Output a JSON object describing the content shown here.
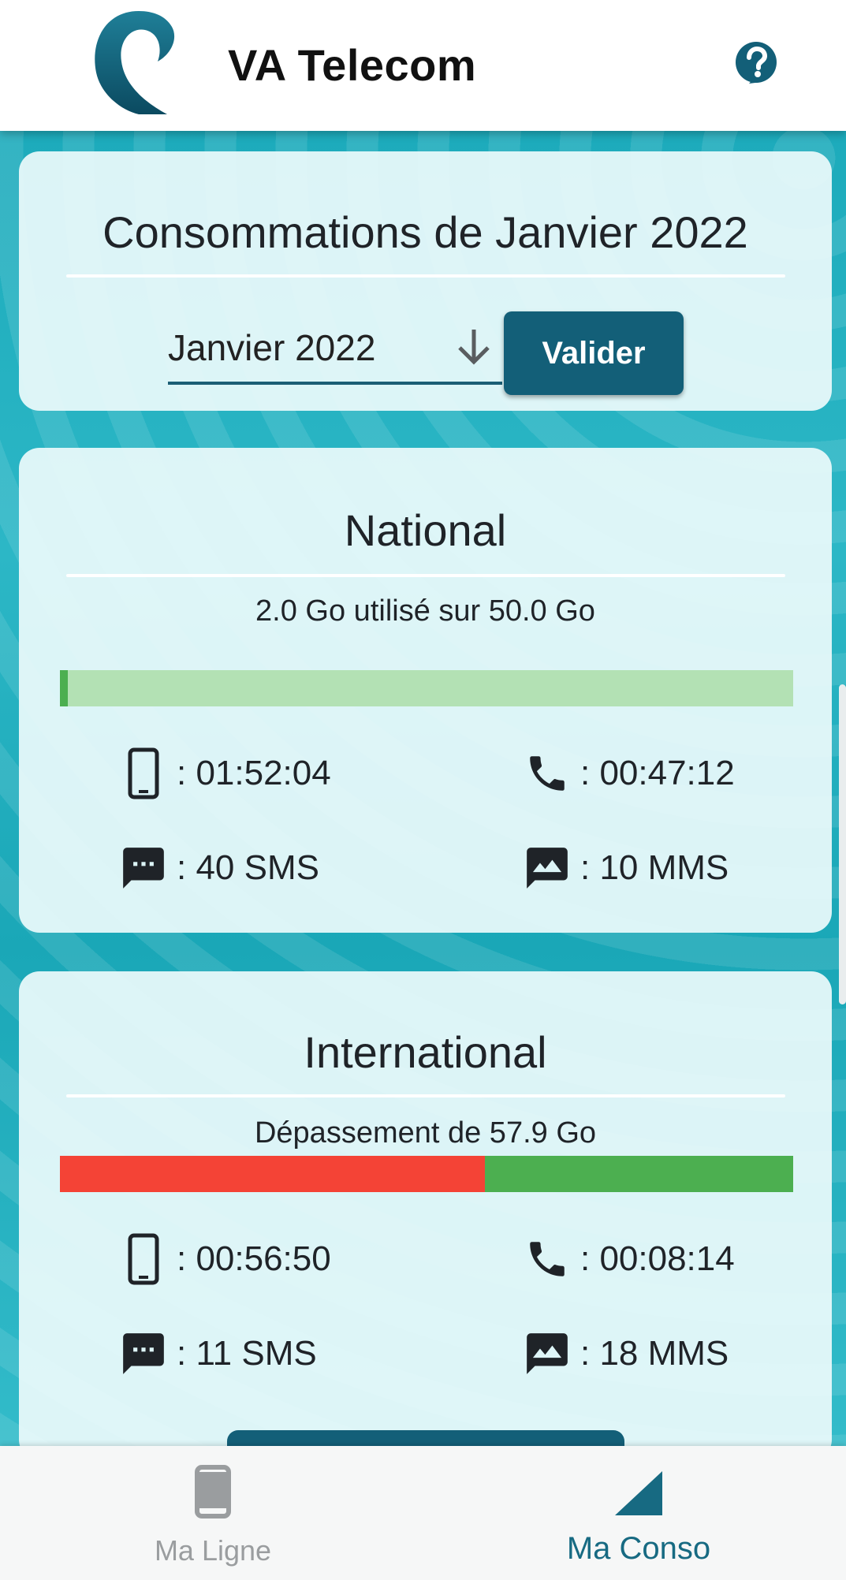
{
  "header": {
    "app_title": "VA Telecom",
    "logo_icon": "va-telecom-logo",
    "help_icon": "help-circle-icon",
    "brand_color": "#135f78"
  },
  "month_card": {
    "title": "Consommations de Janvier 2022",
    "selected_month": "Janvier 2022",
    "dropdown_icon": "arrow-down-icon",
    "validate_label": "Valider"
  },
  "national": {
    "title": "National",
    "usage_text": "2.0 Go utilisé sur 50.0 Go",
    "data_used_fraction": 0.04,
    "bar_fill_color": "#4caf50",
    "bar_rest_color": "#b3e1b4",
    "stats": {
      "mobile_time": ": 01:52:04",
      "call_time": ": 00:47:12",
      "sms": ": 40 SMS",
      "mms": ": 10 MMS"
    }
  },
  "international": {
    "title": "International",
    "usage_text": "Dépassement de 57.9 Go",
    "overage_fraction": 0.58,
    "bar_fill_color": "#f44336",
    "bar_rest_color": "#4caf50",
    "stats": {
      "mobile_time": ": 00:56:50",
      "call_time": ": 00:08:14",
      "sms": ": 11 SMS",
      "mms": ": 18 MMS"
    }
  },
  "bottom_nav": {
    "items": [
      {
        "label": "Ma Ligne",
        "icon": "smartphone-icon",
        "active": false
      },
      {
        "label": "Ma Conso",
        "icon": "triangle-chart-icon",
        "active": true
      }
    ]
  }
}
